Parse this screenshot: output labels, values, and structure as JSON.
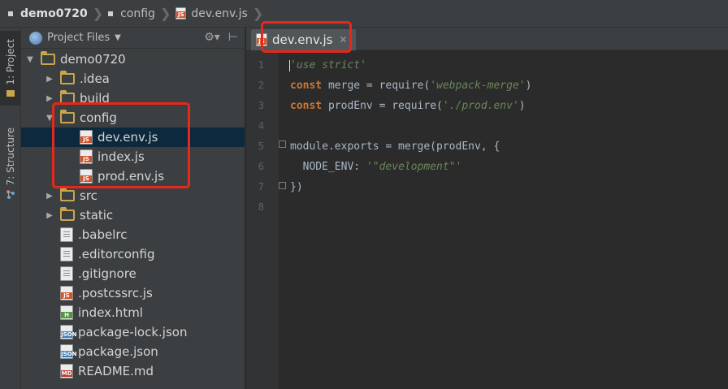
{
  "breadcrumbs": [
    "demo0720",
    "config",
    "dev.env.js"
  ],
  "toolstrip": {
    "project_tab": "1: Project",
    "structure_tab": "7: Structure"
  },
  "project_panel": {
    "title": "Project Files",
    "tree": [
      {
        "label": "demo0720",
        "kind": "folder",
        "depth": 0,
        "expanded": true
      },
      {
        "label": ".idea",
        "kind": "folder",
        "depth": 1,
        "expanded": false
      },
      {
        "label": "build",
        "kind": "folder",
        "depth": 1,
        "expanded": false
      },
      {
        "label": "config",
        "kind": "folder",
        "depth": 1,
        "expanded": true
      },
      {
        "label": "dev.env.js",
        "kind": "js",
        "depth": 2,
        "selected": true
      },
      {
        "label": "index.js",
        "kind": "js",
        "depth": 2
      },
      {
        "label": "prod.env.js",
        "kind": "js",
        "depth": 2
      },
      {
        "label": "src",
        "kind": "folder",
        "depth": 1,
        "expanded": false
      },
      {
        "label": "static",
        "kind": "folder",
        "depth": 1,
        "expanded": false
      },
      {
        "label": ".babelrc",
        "kind": "txt",
        "depth": 1
      },
      {
        "label": ".editorconfig",
        "kind": "txt",
        "depth": 1
      },
      {
        "label": ".gitignore",
        "kind": "txt",
        "depth": 1
      },
      {
        "label": ".postcssrc.js",
        "kind": "js",
        "depth": 1
      },
      {
        "label": "index.html",
        "kind": "html",
        "depth": 1
      },
      {
        "label": "package-lock.json",
        "kind": "json",
        "depth": 1
      },
      {
        "label": "package.json",
        "kind": "json",
        "depth": 1
      },
      {
        "label": "README.md",
        "kind": "md",
        "depth": 1
      }
    ]
  },
  "editor": {
    "active_tab": "dev.env.js",
    "line_numbers": [
      "1",
      "2",
      "3",
      "4",
      "5",
      "6",
      "7",
      "8"
    ],
    "lines": [
      {
        "indent": "",
        "parts": [
          {
            "t": "str",
            "v": "'use strict'"
          }
        ]
      },
      {
        "indent": "",
        "parts": [
          {
            "t": "kw",
            "v": "const"
          },
          {
            "t": "plain",
            "v": " merge = require("
          },
          {
            "t": "str",
            "v": "'webpack-merge'"
          },
          {
            "t": "plain",
            "v": ")"
          }
        ]
      },
      {
        "indent": "",
        "parts": [
          {
            "t": "kw",
            "v": "const"
          },
          {
            "t": "plain",
            "v": " prodEnv = require("
          },
          {
            "t": "str",
            "v": "'./prod.env'"
          },
          {
            "t": "plain",
            "v": ")"
          }
        ]
      },
      {
        "indent": "",
        "parts": []
      },
      {
        "indent": "",
        "parts": [
          {
            "t": "plain",
            "v": "module.exports = merge(prodEnv, {"
          }
        ]
      },
      {
        "indent": "  ",
        "parts": [
          {
            "t": "plain",
            "v": "NODE_ENV: "
          },
          {
            "t": "str",
            "v": "'\"development\"'"
          }
        ]
      },
      {
        "indent": "",
        "parts": [
          {
            "t": "plain",
            "v": "})"
          }
        ]
      },
      {
        "indent": "",
        "parts": []
      }
    ]
  },
  "colors": {
    "annotation": "#e8271c",
    "selection": "#0d293e",
    "keyword": "#cc7832",
    "string": "#6a8759"
  }
}
